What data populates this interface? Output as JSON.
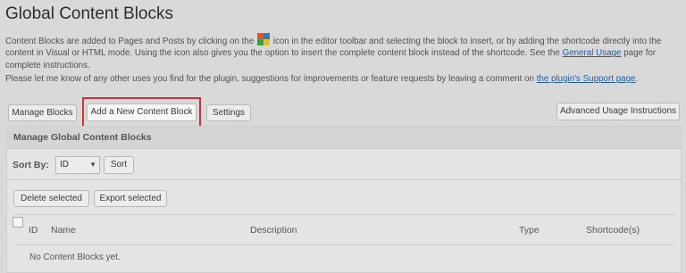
{
  "page": {
    "title": "Global Content Blocks"
  },
  "intro": {
    "p1_before_icon": "Content Blocks are added to Pages and Posts by clicking on the",
    "p1_after_icon": "icon in the editor toolbar and selecting the block to insert, or by adding the shortcode directly into the content in Visual or HTML mode. Using the icon also gives you the option to insert the complete content block instead of the shortcode. See the",
    "p1_link": "General Usage",
    "p1_end": "page for complete instructions.",
    "p2_before_link": "Please let me know of any other uses you find for the plugin, suggestions for improvements or feature requests by leaving a comment on",
    "p2_link": "the plugin's Support page",
    "p2_end": ".",
    "icon_name": "global-content-blocks-toolbar-icon"
  },
  "tabs": {
    "manage_blocks": "Manage Blocks",
    "add_new": "Add a New Content Block",
    "settings": "Settings",
    "advanced": "Advanced Usage Instructions"
  },
  "panel": {
    "header": "Manage Global Content Blocks",
    "sort_by_label": "Sort By:",
    "sort_value": "ID",
    "sort_button": "Sort",
    "delete_selected": "Delete selected",
    "export_selected": "Export selected",
    "columns": {
      "id": "ID",
      "name": "Name",
      "description": "Description",
      "type": "Type",
      "shortcode": "Shortcode(s)"
    },
    "empty_message": "No Content Blocks yet."
  },
  "colors": {
    "highlight_border": "#d0303a",
    "link": "#1e5ea8"
  }
}
